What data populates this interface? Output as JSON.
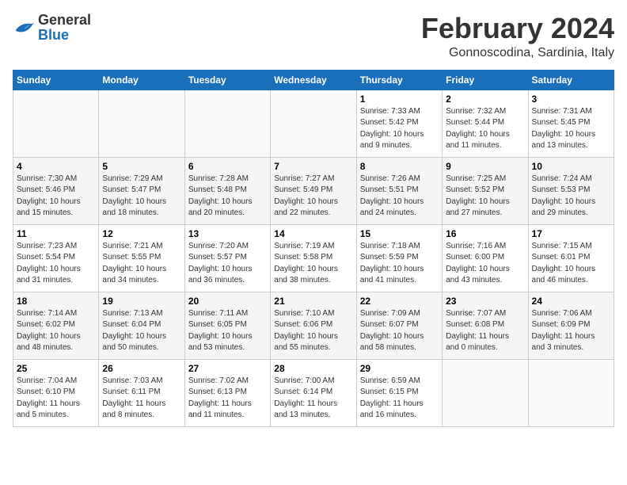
{
  "header": {
    "logo_general": "General",
    "logo_blue": "Blue",
    "title": "February 2024",
    "subtitle": "Gonnoscodina, Sardinia, Italy"
  },
  "weekdays": [
    "Sunday",
    "Monday",
    "Tuesday",
    "Wednesday",
    "Thursday",
    "Friday",
    "Saturday"
  ],
  "rows": [
    [
      {
        "day": "",
        "info": ""
      },
      {
        "day": "",
        "info": ""
      },
      {
        "day": "",
        "info": ""
      },
      {
        "day": "",
        "info": ""
      },
      {
        "day": "1",
        "info": "Sunrise: 7:33 AM\nSunset: 5:42 PM\nDaylight: 10 hours\nand 9 minutes."
      },
      {
        "day": "2",
        "info": "Sunrise: 7:32 AM\nSunset: 5:44 PM\nDaylight: 10 hours\nand 11 minutes."
      },
      {
        "day": "3",
        "info": "Sunrise: 7:31 AM\nSunset: 5:45 PM\nDaylight: 10 hours\nand 13 minutes."
      }
    ],
    [
      {
        "day": "4",
        "info": "Sunrise: 7:30 AM\nSunset: 5:46 PM\nDaylight: 10 hours\nand 15 minutes."
      },
      {
        "day": "5",
        "info": "Sunrise: 7:29 AM\nSunset: 5:47 PM\nDaylight: 10 hours\nand 18 minutes."
      },
      {
        "day": "6",
        "info": "Sunrise: 7:28 AM\nSunset: 5:48 PM\nDaylight: 10 hours\nand 20 minutes."
      },
      {
        "day": "7",
        "info": "Sunrise: 7:27 AM\nSunset: 5:49 PM\nDaylight: 10 hours\nand 22 minutes."
      },
      {
        "day": "8",
        "info": "Sunrise: 7:26 AM\nSunset: 5:51 PM\nDaylight: 10 hours\nand 24 minutes."
      },
      {
        "day": "9",
        "info": "Sunrise: 7:25 AM\nSunset: 5:52 PM\nDaylight: 10 hours\nand 27 minutes."
      },
      {
        "day": "10",
        "info": "Sunrise: 7:24 AM\nSunset: 5:53 PM\nDaylight: 10 hours\nand 29 minutes."
      }
    ],
    [
      {
        "day": "11",
        "info": "Sunrise: 7:23 AM\nSunset: 5:54 PM\nDaylight: 10 hours\nand 31 minutes."
      },
      {
        "day": "12",
        "info": "Sunrise: 7:21 AM\nSunset: 5:55 PM\nDaylight: 10 hours\nand 34 minutes."
      },
      {
        "day": "13",
        "info": "Sunrise: 7:20 AM\nSunset: 5:57 PM\nDaylight: 10 hours\nand 36 minutes."
      },
      {
        "day": "14",
        "info": "Sunrise: 7:19 AM\nSunset: 5:58 PM\nDaylight: 10 hours\nand 38 minutes."
      },
      {
        "day": "15",
        "info": "Sunrise: 7:18 AM\nSunset: 5:59 PM\nDaylight: 10 hours\nand 41 minutes."
      },
      {
        "day": "16",
        "info": "Sunrise: 7:16 AM\nSunset: 6:00 PM\nDaylight: 10 hours\nand 43 minutes."
      },
      {
        "day": "17",
        "info": "Sunrise: 7:15 AM\nSunset: 6:01 PM\nDaylight: 10 hours\nand 46 minutes."
      }
    ],
    [
      {
        "day": "18",
        "info": "Sunrise: 7:14 AM\nSunset: 6:02 PM\nDaylight: 10 hours\nand 48 minutes."
      },
      {
        "day": "19",
        "info": "Sunrise: 7:13 AM\nSunset: 6:04 PM\nDaylight: 10 hours\nand 50 minutes."
      },
      {
        "day": "20",
        "info": "Sunrise: 7:11 AM\nSunset: 6:05 PM\nDaylight: 10 hours\nand 53 minutes."
      },
      {
        "day": "21",
        "info": "Sunrise: 7:10 AM\nSunset: 6:06 PM\nDaylight: 10 hours\nand 55 minutes."
      },
      {
        "day": "22",
        "info": "Sunrise: 7:09 AM\nSunset: 6:07 PM\nDaylight: 10 hours\nand 58 minutes."
      },
      {
        "day": "23",
        "info": "Sunrise: 7:07 AM\nSunset: 6:08 PM\nDaylight: 11 hours\nand 0 minutes."
      },
      {
        "day": "24",
        "info": "Sunrise: 7:06 AM\nSunset: 6:09 PM\nDaylight: 11 hours\nand 3 minutes."
      }
    ],
    [
      {
        "day": "25",
        "info": "Sunrise: 7:04 AM\nSunset: 6:10 PM\nDaylight: 11 hours\nand 5 minutes."
      },
      {
        "day": "26",
        "info": "Sunrise: 7:03 AM\nSunset: 6:11 PM\nDaylight: 11 hours\nand 8 minutes."
      },
      {
        "day": "27",
        "info": "Sunrise: 7:02 AM\nSunset: 6:13 PM\nDaylight: 11 hours\nand 11 minutes."
      },
      {
        "day": "28",
        "info": "Sunrise: 7:00 AM\nSunset: 6:14 PM\nDaylight: 11 hours\nand 13 minutes."
      },
      {
        "day": "29",
        "info": "Sunrise: 6:59 AM\nSunset: 6:15 PM\nDaylight: 11 hours\nand 16 minutes."
      },
      {
        "day": "",
        "info": ""
      },
      {
        "day": "",
        "info": ""
      }
    ]
  ]
}
